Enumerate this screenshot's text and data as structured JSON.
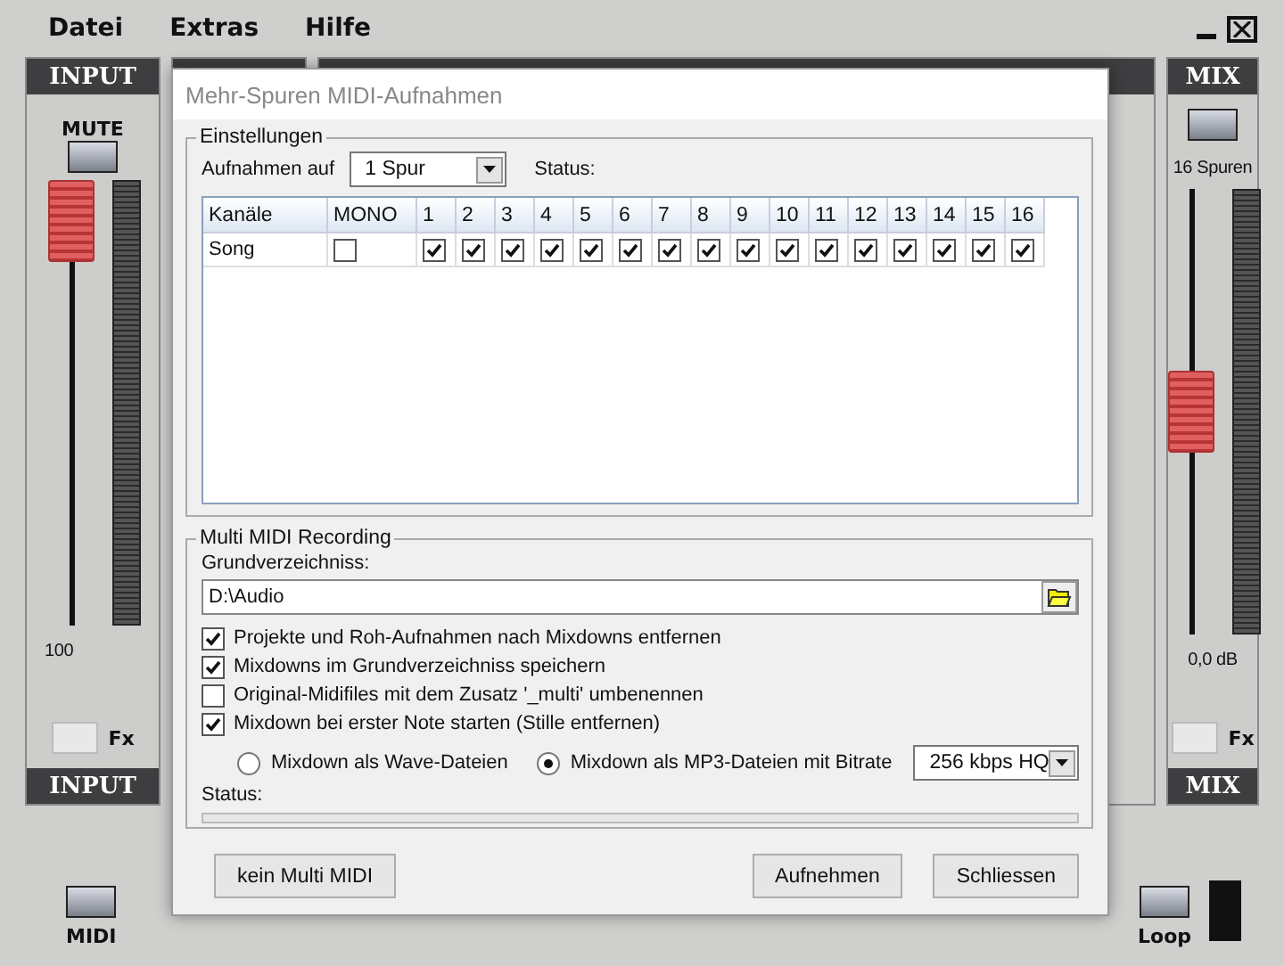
{
  "menu": [
    "Datei",
    "Extras",
    "Hilfe"
  ],
  "input_strip": {
    "header": "INPUT",
    "mute_label": "MUTE",
    "fader": {
      "level": 1
    },
    "reading": "100",
    "fx_label": "Fx",
    "footer": "INPUT",
    "midi_label": "MIDI"
  },
  "mix_strip": {
    "header": "MIX",
    "tracks_label": "16 Spuren",
    "fader": {
      "level": 0.5
    },
    "reading": "0,0 dB",
    "fx_label": "Fx",
    "footer": "MIX",
    "loop_label": "Loop"
  },
  "dialog": {
    "title": "Mehr-Spuren MIDI-Aufnahmen",
    "settings": {
      "legend": "Einstellungen",
      "record_label": "Aufnahmen auf",
      "record_select": "1 Spur",
      "status_label": "Status:",
      "columns": [
        "Kanäle",
        "MONO",
        "1",
        "2",
        "3",
        "4",
        "5",
        "6",
        "7",
        "8",
        "9",
        "10",
        "11",
        "12",
        "13",
        "14",
        "15",
        "16"
      ],
      "rows": [
        {
          "name": "Song",
          "mono": false,
          "channels": [
            true,
            true,
            true,
            true,
            true,
            true,
            true,
            true,
            true,
            true,
            true,
            true,
            true,
            true,
            true,
            true
          ]
        }
      ]
    },
    "recording": {
      "legend": "Multi MIDI Recording",
      "dir_label": "Grundverzeichniss:",
      "dir_value": "D:\\Audio",
      "options": [
        {
          "label": "Projekte und Roh-Aufnahmen nach Mixdowns entfernen",
          "checked": true
        },
        {
          "label": "Mixdowns im Grundverzeichniss speichern",
          "checked": true
        },
        {
          "label": "Original-Midifiles mit dem Zusatz '_multi' umbenennen",
          "checked": false
        },
        {
          "label": "Mixdown bei erster Note starten (Stille entfernen)",
          "checked": true
        }
      ],
      "formats": [
        {
          "label": "Mixdown als Wave-Dateien",
          "selected": false
        },
        {
          "label": "Mixdown als MP3-Dateien mit Bitrate",
          "selected": true
        }
      ],
      "bitrate": "256 kbps HQ",
      "status_label": "Status:",
      "progress": {
        "level": 0
      }
    },
    "buttons": {
      "left": "kein Multi MIDI",
      "right": [
        "Aufnehmen",
        "Schliessen"
      ]
    }
  }
}
